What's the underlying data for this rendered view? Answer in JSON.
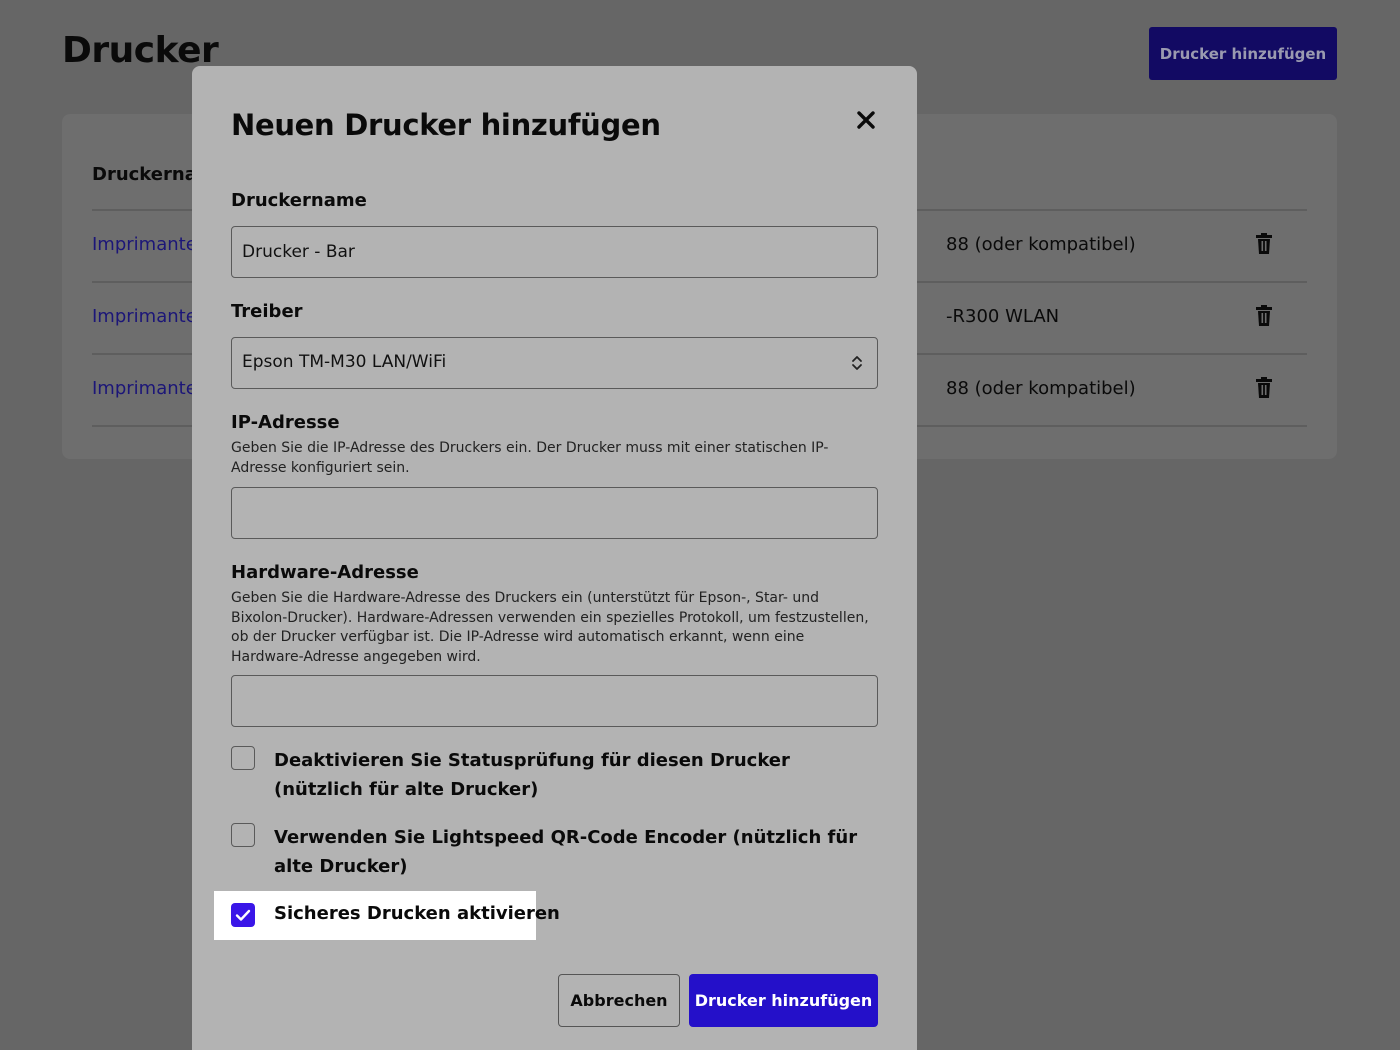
{
  "page": {
    "title": "Drucker",
    "add_button": "Drucker hinzufügen"
  },
  "list": {
    "header": "Druckernan",
    "rows": [
      {
        "name": "Imprimante",
        "driver": "88 (oder kompatibel)"
      },
      {
        "name": "Imprimante",
        "driver": "-R300 WLAN"
      },
      {
        "name": "Imprimante",
        "driver": "88 (oder kompatibel)"
      }
    ]
  },
  "modal": {
    "title": "Neuen Drucker hinzufügen",
    "name_label": "Druckername",
    "name_value": "Drucker - Bar",
    "driver_label": "Treiber",
    "driver_value": "Epson TM-M30 LAN/WiFi",
    "ip_label": "IP-Adresse",
    "ip_help": "Geben Sie die IP-Adresse des Druckers ein. Der Drucker muss mit einer statischen IP-Adresse konfiguriert sein.",
    "ip_value": "",
    "hw_label": "Hardware-Adresse",
    "hw_help": "Geben Sie die Hardware-Adresse des Druckers ein (unterstützt für Epson-, Star- und Bixolon-Drucker). Hardware-Adressen verwenden ein spezielles Protokoll, um festzustellen, ob der Drucker verfügbar ist. Die IP-Adresse wird automatisch erkannt, wenn eine Hardware-Adresse angegeben wird.",
    "hw_value": "",
    "checkboxes": [
      {
        "label": "Deaktivieren Sie Statusprüfung für diesen Drucker (nützlich für alte Drucker)",
        "checked": false
      },
      {
        "label": "Verwenden Sie Lightspeed QR-Code Encoder (nützlich für alte Drucker)",
        "checked": false
      },
      {
        "label": "Sicheres Drucken aktivieren",
        "checked": true
      }
    ],
    "cancel_button": "Abbrechen",
    "submit_button": "Drucker hinzufügen"
  },
  "colors": {
    "primary": "#2410c9",
    "checkbox_checked": "#3a16e8",
    "highlight": "#ffffff",
    "link": "#1c1678"
  },
  "icons": {
    "close": "close-icon",
    "trash": "trash-icon",
    "select_caret": "chevron-updown-icon",
    "check": "check-icon"
  }
}
